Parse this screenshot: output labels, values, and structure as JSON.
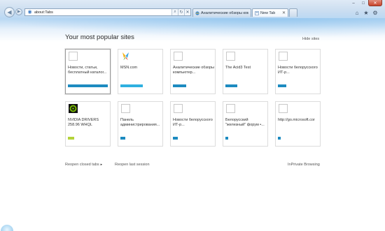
{
  "browser": {
    "address_value": "about:Tabs",
    "tabs": [
      {
        "label": "Аналитические обзоры ком..."
      },
      {
        "label": "New Tab"
      }
    ],
    "window_controls": {
      "minimize": "–",
      "maximize": "□",
      "close": "✕"
    },
    "nav": {
      "back_glyph": "◀",
      "forward_glyph": "▶"
    },
    "address_buttons": {
      "refresh": "↻",
      "stop": "✕"
    },
    "toolbar_icons": [
      {
        "name": "home-icon",
        "glyph": "⌂"
      },
      {
        "name": "favorites-icon",
        "glyph": "★"
      },
      {
        "name": "tools-icon",
        "glyph": "⚙"
      }
    ]
  },
  "page": {
    "title": "Your most popular sites",
    "hide_sites": "Hide sites",
    "tiles_row1": [
      {
        "title": "Новости, статьи, бесплатный каталог...",
        "bar_fill": 1.0,
        "bar_color": "#1d8bc0",
        "favicon": "blank"
      },
      {
        "title": "MSN.com",
        "bar_fill": 0.56,
        "bar_color": "#2fb0e0",
        "favicon": "msn"
      },
      {
        "title": "Аналитические обзоры компьютер...",
        "bar_fill": 0.34,
        "bar_color": "#1d8bc0",
        "favicon": "blank"
      },
      {
        "title": "The Acid3 Test",
        "bar_fill": 0.3,
        "bar_color": "#1d8bc0",
        "favicon": "blank"
      },
      {
        "title": "Новости белорусского ИТ-р...",
        "bar_fill": 0.21,
        "bar_color": "#1d8bc0",
        "favicon": "blank"
      }
    ],
    "tiles_row2": [
      {
        "title": "NVIDIA DRIVERS 258.96 WHQL",
        "bar_fill": 0.15,
        "bar_color": "#b4d33a",
        "favicon": "nvidia"
      },
      {
        "title": "Панель администрирования...",
        "bar_fill": 0.13,
        "bar_color": "#1d8bc0",
        "favicon": "blank"
      },
      {
        "title": "Новости белорусского ИТ-р...",
        "bar_fill": 0.13,
        "bar_color": "#1d8bc0",
        "favicon": "blank"
      },
      {
        "title": "Белорусский \"железный\" форум •...",
        "bar_fill": 0.07,
        "bar_color": "#1d8bc0",
        "favicon": "blank"
      },
      {
        "title": "http://go.microsoft.cor",
        "bar_fill": 0.06,
        "bar_color": "#1d8bc0",
        "favicon": "blank"
      }
    ],
    "footer": {
      "reopen_closed": "Reopen closed tabs",
      "reopen_closed_caret": "▸",
      "reopen_last": "Reopen last session",
      "inprivate": "InPrivate Browsing"
    }
  }
}
